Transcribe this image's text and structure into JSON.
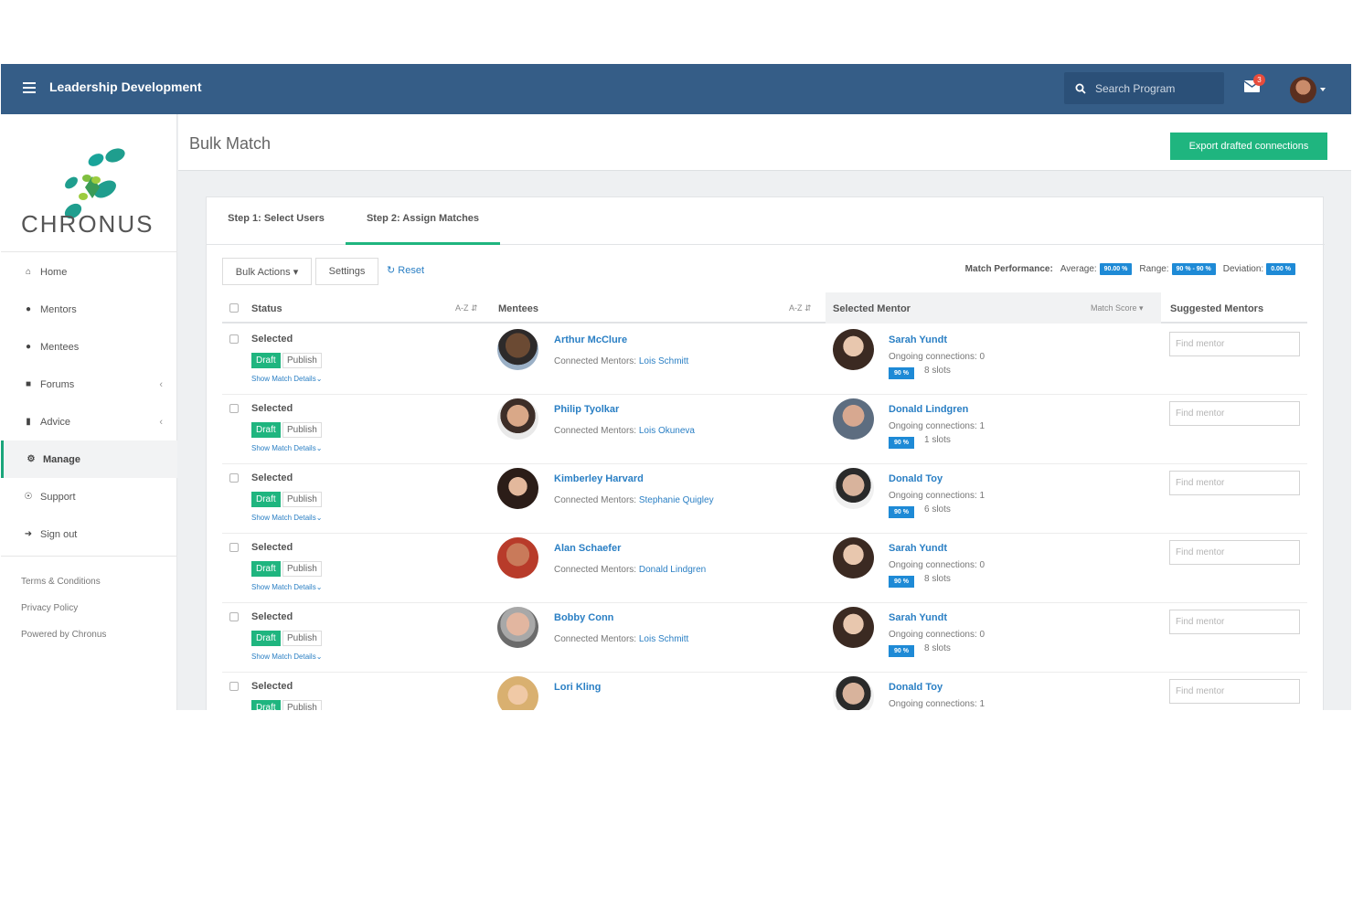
{
  "app": {
    "title": "Leadership Development"
  },
  "search": {
    "placeholder": "Search Program"
  },
  "notifications": {
    "count": "3"
  },
  "brand": {
    "logo_text": "CHRONUS",
    "accent": "#1fb57f",
    "topbar_color": "#355d87",
    "link_color": "#2a7fc4"
  },
  "sidebar": {
    "items": [
      {
        "label": "Home",
        "icon": "home-icon"
      },
      {
        "label": "Mentors",
        "icon": "user-icon"
      },
      {
        "label": "Mentees",
        "icon": "user-icon"
      },
      {
        "label": "Forums",
        "icon": "comments-icon"
      },
      {
        "label": "Advice",
        "icon": "file-icon"
      },
      {
        "label": "Manage",
        "icon": "cogs-icon"
      },
      {
        "label": "Support",
        "icon": "lifebuoy-icon"
      },
      {
        "label": "Sign out",
        "icon": "sign-out-icon"
      }
    ],
    "footer": [
      "Terms & Conditions",
      "Privacy Policy",
      "Powered by Chronus"
    ]
  },
  "page": {
    "title": "Bulk Match",
    "export_label": "Export drafted connections"
  },
  "tabs": [
    "Step 1: Select Users",
    "Step 2: Assign Matches"
  ],
  "toolbar": {
    "bulk_actions": "Bulk Actions",
    "settings": "Settings",
    "reset": "Reset"
  },
  "performance": {
    "label": "Match Performance:",
    "average_label": "Average:",
    "average": "90.00 %",
    "range_label": "Range:",
    "range": "90 % - 90 %",
    "deviation_label": "Deviation:",
    "deviation": "0.00 %"
  },
  "table": {
    "headers": {
      "status": "Status",
      "mentees": "Mentees",
      "selected_mentor": "Selected Mentor",
      "suggested": "Suggested Mentors",
      "az": "A-Z",
      "match_score": "Match Score"
    },
    "rows": [
      {
        "status": "Selected",
        "draft": "Draft",
        "publish": "Publish",
        "details": "Show Match Details",
        "mentee": "Arthur McClure",
        "connected_label": "Connected Mentors:",
        "connected": "Lois Schmitt",
        "mentor": "Sarah Yundt",
        "ongoing": "Ongoing connections: 0",
        "score": "90 %",
        "slots": "8 slots",
        "find_placeholder": "Find mentor"
      },
      {
        "status": "Selected",
        "draft": "Draft",
        "publish": "Publish",
        "details": "Show Match Details",
        "mentee": "Philip Tyolkar",
        "connected_label": "Connected Mentors:",
        "connected": "Lois Okuneva",
        "mentor": "Donald Lindgren",
        "ongoing": "Ongoing connections: 1",
        "score": "90 %",
        "slots": "1 slots",
        "find_placeholder": "Find mentor"
      },
      {
        "status": "Selected",
        "draft": "Draft",
        "publish": "Publish",
        "details": "Show Match Details",
        "mentee": "Kimberley Harvard",
        "connected_label": "Connected Mentors:",
        "connected": "Stephanie Quigley",
        "mentor": "Donald Toy",
        "ongoing": "Ongoing connections: 1",
        "score": "90 %",
        "slots": "6 slots",
        "find_placeholder": "Find mentor"
      },
      {
        "status": "Selected",
        "draft": "Draft",
        "publish": "Publish",
        "details": "Show Match Details",
        "mentee": "Alan Schaefer",
        "connected_label": "Connected Mentors:",
        "connected": "Donald Lindgren",
        "mentor": "Sarah Yundt",
        "ongoing": "Ongoing connections: 0",
        "score": "90 %",
        "slots": "8 slots",
        "find_placeholder": "Find mentor"
      },
      {
        "status": "Selected",
        "draft": "Draft",
        "publish": "Publish",
        "details": "Show Match Details",
        "mentee": "Bobby Conn",
        "connected_label": "Connected Mentors:",
        "connected": "Lois Schmitt",
        "mentor": "Sarah Yundt",
        "ongoing": "Ongoing connections: 0",
        "score": "90 %",
        "slots": "8 slots",
        "find_placeholder": "Find mentor"
      },
      {
        "status": "Selected",
        "draft": "Draft",
        "publish": "Publish",
        "details": "",
        "mentee": "Lori Kling",
        "connected_label": "",
        "connected": "",
        "mentor": "Donald Toy",
        "ongoing": "Ongoing connections: 1",
        "score": "",
        "slots": "",
        "find_placeholder": "Find mentor"
      }
    ]
  }
}
